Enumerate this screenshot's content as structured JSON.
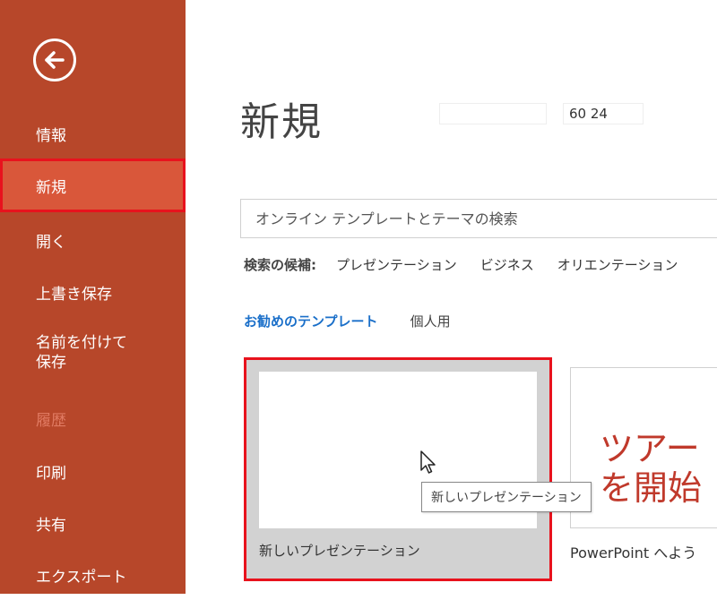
{
  "sidebar": {
    "back_icon": "back-arrow-icon",
    "items": [
      {
        "label": "情報"
      },
      {
        "label": "新規"
      },
      {
        "label": "開く"
      },
      {
        "label": "上書き保存"
      },
      {
        "label": "名前を付けて\n保存"
      },
      {
        "label": "履歴"
      },
      {
        "label": "印刷"
      },
      {
        "label": "共有"
      },
      {
        "label": "エクスポート"
      }
    ]
  },
  "main": {
    "title": "新規",
    "title_number": "60  24",
    "search": {
      "placeholder": "オンライン テンプレートとテーマの検索"
    },
    "suggestions": {
      "label": "検索の候補:",
      "links": [
        "プレゼンテーション",
        "ビジネス",
        "オリエンテーション"
      ]
    },
    "tabs": [
      {
        "label": "お勧めのテンプレート"
      },
      {
        "label": "個人用"
      }
    ],
    "templates": [
      {
        "caption": "新しいプレゼンテーション",
        "tooltip": "新しいプレゼンテーション"
      },
      {
        "thumb_text": "ツアー\nを開始",
        "caption": "PowerPoint へよう"
      }
    ]
  },
  "colors": {
    "sidebar_bg": "#b7472a",
    "active_item_bg": "#d9573a",
    "highlight_border": "#e8121d",
    "tab_active": "#1a6fc9",
    "tour_text": "#c0392b"
  }
}
